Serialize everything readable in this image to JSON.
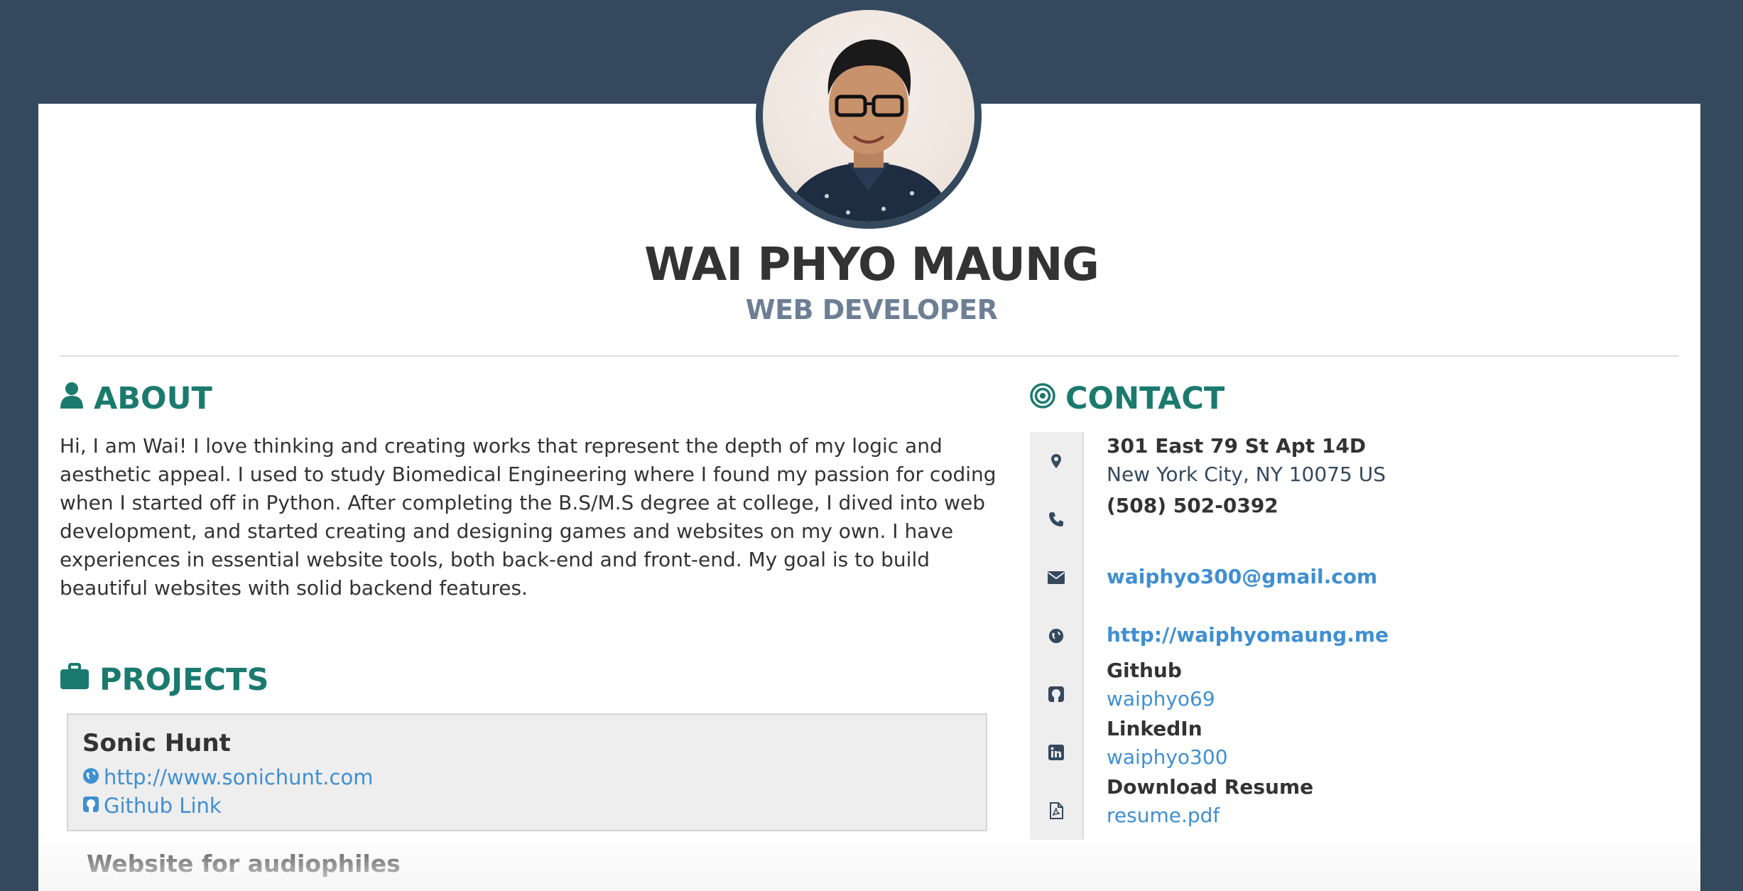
{
  "profile": {
    "name": "WAI PHYO MAUNG",
    "role": "WEB DEVELOPER"
  },
  "about": {
    "heading": "ABOUT",
    "text": "Hi, I am Wai! I love thinking and creating works that represent the depth of my logic and aesthetic appeal. I used to study Biomedical Engineering where I found my passion for coding when I started off in Python. After completing the B.S/M.S degree at college, I dived into web development, and started creating and designing games and websites on my own. I have experiences in essential website tools, both back-end and front-end. My goal is to build beautiful websites with solid backend features."
  },
  "projects": {
    "heading": "PROJECTS",
    "items": [
      {
        "title": "Sonic Hunt",
        "url": "http://www.sonichunt.com",
        "github": "Github Link"
      },
      {
        "title": "Website for audiophiles"
      }
    ]
  },
  "contact": {
    "heading": "CONTACT",
    "address_line1": "301 East 79 St Apt 14D",
    "address_line2": "New York City, NY 10075 US",
    "phone": "(508) 502-0392",
    "email": "waiphyo300@gmail.com",
    "website": "http://waiphyomaung.me",
    "github_label": "Github",
    "github_user": "waiphyo69",
    "linkedin_label": "LinkedIn",
    "linkedin_user": "waiphyo300",
    "resume_label": "Download Resume",
    "resume_file": "resume.pdf"
  },
  "colors": {
    "background": "#34495e",
    "accent": "#1b7a6e",
    "link": "#3f8fd2",
    "role": "#6d7f94"
  }
}
